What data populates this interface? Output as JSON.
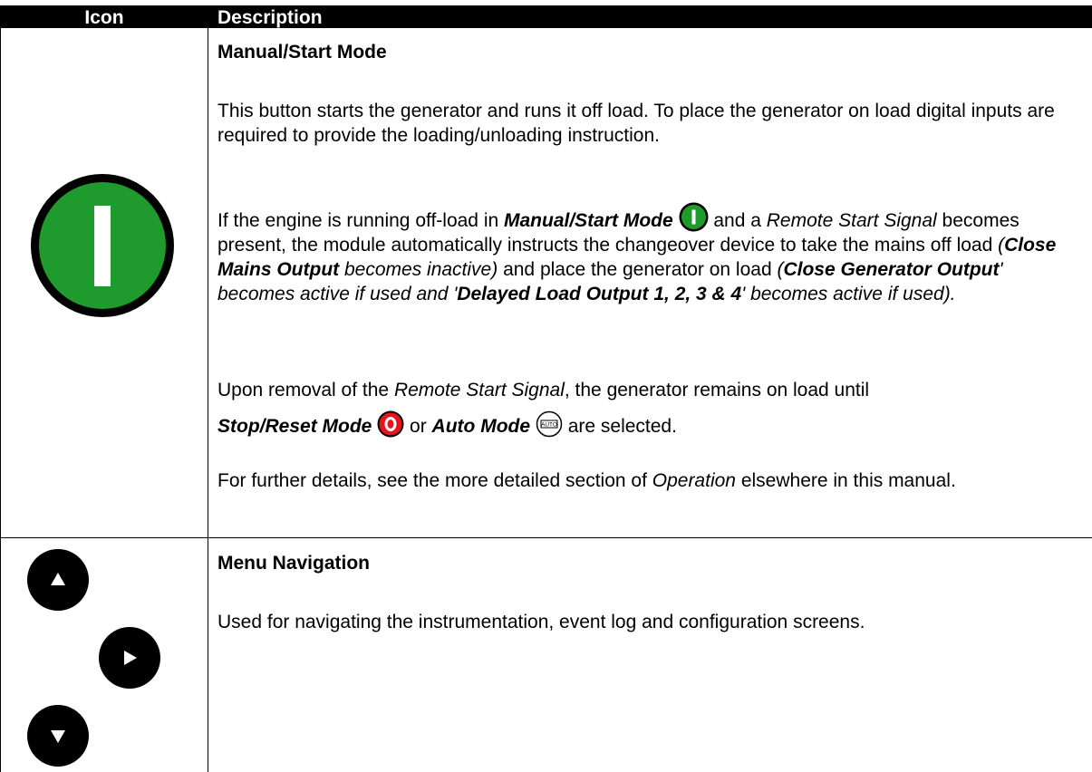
{
  "table": {
    "header": {
      "icon_col": "Icon",
      "description_col": "Description"
    }
  },
  "manual_row": {
    "title": "Manual/Start Mode",
    "p1": "This button starts the generator and runs it off load. To place the generator on load digital inputs are required to provide the loading/unloading instruction.",
    "p2": {
      "a": "If the engine is running off-load in ",
      "b": "Manual/Start Mode",
      "c": " and a ",
      "d": "Remote Start Signal",
      "e": " becomes present, the module automatically instructs the changeover device to take the mains off load ",
      "f": "(",
      "g": "Close Mains Output",
      "h": " becomes inactive)",
      "i": " and place the generator on load ",
      "j": "(",
      "k": "Close Generator Output",
      "l": "' becomes active if used and '",
      "m": "Delayed Load Output 1, 2, 3 & 4",
      "n": "' becomes active if used)."
    },
    "p3": {
      "a": "Upon removal of the ",
      "b": "Remote Start Signal",
      "c": ", the generator remains on load until",
      "d": "Stop/Reset Mode",
      "e": " or ",
      "f": "Auto Mode",
      "g": " are selected."
    },
    "p4": {
      "a": "For further details, see the more detailed section of ",
      "b": "Operation",
      "c": " elsewhere in this manual."
    },
    "icons": {
      "start_glyph": "I",
      "stop_glyph": "O",
      "auto_glyph": "AUTO",
      "start_color": "#1f9a2c",
      "stop_color": "#e8141b"
    }
  },
  "menu_row": {
    "title": "Menu Navigation",
    "p1": "Used for navigating the instrumentation, event log and configuration screens."
  }
}
